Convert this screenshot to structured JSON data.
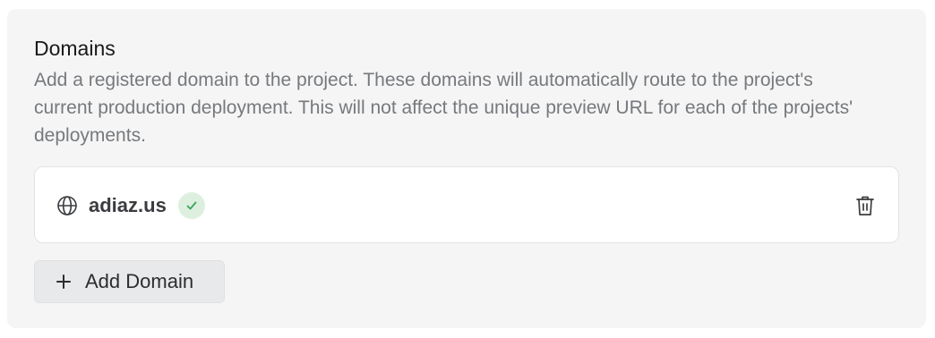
{
  "section": {
    "title": "Domains",
    "description": "Add a registered domain to the project. These domains will automatically route to the project's current production deployment. This will not affect the unique preview URL for each of the projects' deployments."
  },
  "domains": [
    {
      "name": "adiaz.us",
      "status": "verified",
      "icon": "globe-icon",
      "status_icon": "check-icon",
      "action_icon": "trash-icon"
    }
  ],
  "actions": {
    "add_domain_label": "Add Domain",
    "add_domain_icon": "plus-icon"
  },
  "colors": {
    "card_background": "#f5f5f5",
    "verified_badge_bg": "#ddf0df",
    "verified_check": "#3aa55a",
    "button_background": "#e8e9ea"
  }
}
